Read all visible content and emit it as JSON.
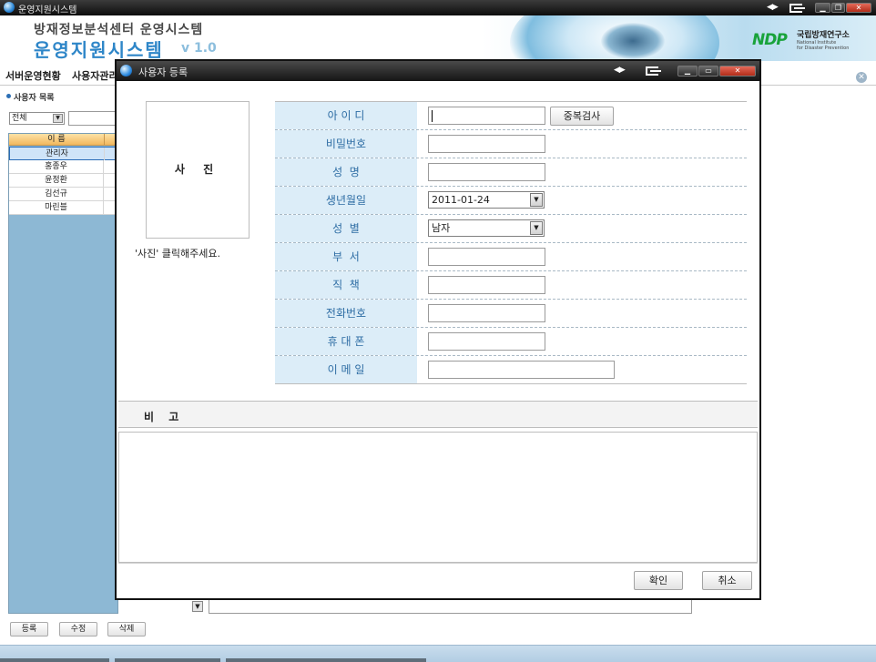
{
  "app": {
    "window_title": "운영지원시스템",
    "header_subtitle": "방재정보분석센터 운영시스템",
    "header_title": "운영지원시스템",
    "version": "v 1.0",
    "logo_text": "NDP",
    "institute_kr": "국립방재연구소",
    "institute_en_1": "National Institute",
    "institute_en_2": "for Disaster Prevention"
  },
  "tabs": [
    {
      "label": "서버운영현황"
    },
    {
      "label": "사용자관리"
    }
  ],
  "user_list": {
    "caption": "사용자 목록",
    "filter_value": "전체",
    "column_header": "이 름",
    "rows": [
      "관리자",
      "홍종우",
      "윤정환",
      "김선규",
      "마린블"
    ]
  },
  "bottom_buttons": {
    "register": "등록",
    "edit": "수정",
    "delete": "삭제"
  },
  "dialog": {
    "title": "사용자 등록",
    "photo_label": "사 진",
    "photo_hint": "'사진' 클릭해주세요.",
    "fields": {
      "id": {
        "label": "아 이 디",
        "value": ""
      },
      "dup_check": "중복검사",
      "password": {
        "label": "비밀번호",
        "value": ""
      },
      "name": {
        "label": "성  명",
        "value": ""
      },
      "birthdate": {
        "label": "생년월일",
        "value": "2011-01-24"
      },
      "gender": {
        "label": "성  별",
        "value": "남자"
      },
      "department": {
        "label": "부  서",
        "value": ""
      },
      "position": {
        "label": "직  책",
        "value": ""
      },
      "phone": {
        "label": "전화번호",
        "value": ""
      },
      "mobile": {
        "label": "휴 대 폰",
        "value": ""
      },
      "email": {
        "label": "이 메 일",
        "value": ""
      }
    },
    "remarks_label": "비 고",
    "confirm": "확인",
    "cancel": "취소"
  }
}
